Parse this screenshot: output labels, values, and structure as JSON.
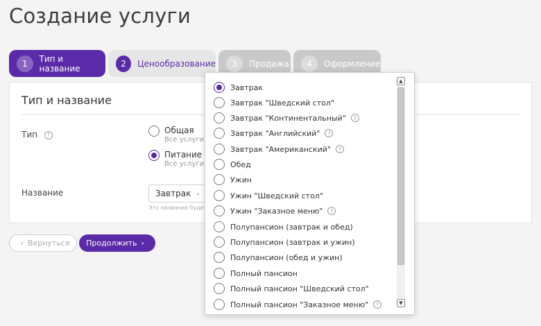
{
  "page": {
    "title": "Создание услуги"
  },
  "steps": [
    {
      "num": "1",
      "label": "Тип и название",
      "state": "active"
    },
    {
      "num": "2",
      "label": "Ценообразование",
      "state": "available"
    },
    {
      "num": "3",
      "label": "Продажа",
      "state": "disabled"
    },
    {
      "num": "4",
      "label": "Оформление",
      "state": "disabled"
    }
  ],
  "card": {
    "title": "Тип и название",
    "type_label": "Тип",
    "type_options": [
      {
        "label": "Общая",
        "sub": "Все услуги, к",
        "checked": false
      },
      {
        "label": "Питание",
        "sub": "Все услуги п",
        "checked": true
      }
    ],
    "name_label": "Название",
    "name_select_value": "Завтрак",
    "name_hint": "Это название будет п"
  },
  "buttons": {
    "back": "Вернуться",
    "next": "Продолжить"
  },
  "dropdown": {
    "items": [
      {
        "label": "Завтрак",
        "checked": true,
        "help": false
      },
      {
        "label": "Завтрак \"Шведский стол\"",
        "checked": false,
        "help": false
      },
      {
        "label": "Завтрак \"Континентальный\"",
        "checked": false,
        "help": true
      },
      {
        "label": "Завтрак \"Английский\"",
        "checked": false,
        "help": true
      },
      {
        "label": "Завтрак \"Американский\"",
        "checked": false,
        "help": true
      },
      {
        "label": "Обед",
        "checked": false,
        "help": false
      },
      {
        "label": "Ужин",
        "checked": false,
        "help": false
      },
      {
        "label": "Ужин \"Шведский стол\"",
        "checked": false,
        "help": false
      },
      {
        "label": "Ужин \"Заказное меню\"",
        "checked": false,
        "help": true
      },
      {
        "label": "Полупансион (завтрак и обед)",
        "checked": false,
        "help": false
      },
      {
        "label": "Полупансион (завтрак и ужин)",
        "checked": false,
        "help": false
      },
      {
        "label": "Полупансион (обед и ужин)",
        "checked": false,
        "help": false
      },
      {
        "label": "Полный пансион",
        "checked": false,
        "help": false
      },
      {
        "label": "Полный пансион \"Шведский стол\"",
        "checked": false,
        "help": false
      },
      {
        "label": "Полный пансион \"Заказное меню\"",
        "checked": false,
        "help": true
      }
    ]
  },
  "colors": {
    "accent": "#5b2aa8",
    "step_disabled": "#c9c9c9",
    "step_inactive": "#e6e6e6"
  }
}
